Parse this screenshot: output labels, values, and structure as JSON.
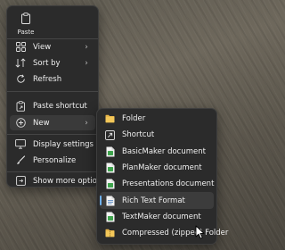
{
  "context_menu": {
    "paste_label": "Paste",
    "items": [
      {
        "label": "View",
        "icon": "view-grid-icon",
        "has_submenu": true
      },
      {
        "label": "Sort by",
        "icon": "sort-icon",
        "has_submenu": true
      },
      {
        "label": "Refresh",
        "icon": "refresh-icon",
        "has_submenu": false
      },
      {
        "label": "Paste shortcut",
        "icon": "paste-shortcut-icon",
        "has_submenu": false
      },
      {
        "label": "New",
        "icon": "new-icon",
        "has_submenu": true
      },
      {
        "label": "Display settings",
        "icon": "display-settings-icon",
        "has_submenu": false
      },
      {
        "label": "Personalize",
        "icon": "personalize-icon",
        "has_submenu": false
      },
      {
        "label": "Show more options",
        "icon": "more-options-icon",
        "has_submenu": false
      }
    ]
  },
  "new_submenu": {
    "items": [
      {
        "label": "Folder",
        "icon": "folder-icon"
      },
      {
        "label": "Shortcut",
        "icon": "shortcut-icon"
      },
      {
        "label": "BasicMaker document",
        "icon": "basicmaker-document-icon"
      },
      {
        "label": "PlanMaker document",
        "icon": "planmaker-document-icon"
      },
      {
        "label": "Presentations document",
        "icon": "presentations-document-icon"
      },
      {
        "label": "Rich Text Format",
        "icon": "rich-text-format-icon"
      },
      {
        "label": "TextMaker document",
        "icon": "textmaker-document-icon"
      },
      {
        "label": "Compressed (zipped) Folder",
        "icon": "compressed-folder-icon"
      }
    ],
    "highlighted_item": "Rich Text Format"
  },
  "colors": {
    "menu_background": "#2b2b2b",
    "hover_background": "#3a3a3a",
    "accent": "#6fb1f0",
    "folder": "#e8b64a",
    "document_green": "#3fa34d"
  }
}
